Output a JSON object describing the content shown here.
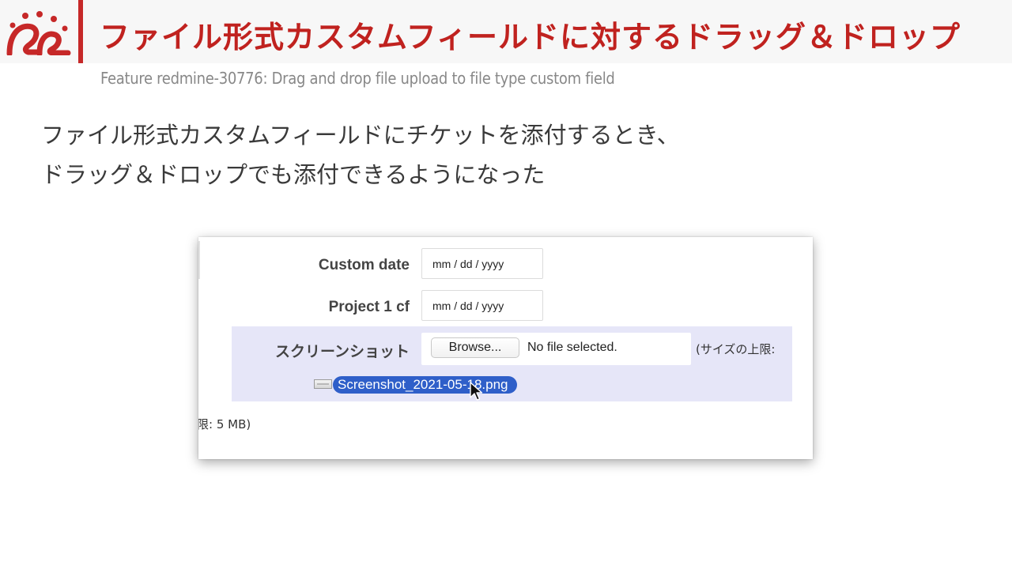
{
  "slide": {
    "title": "ファイル形式カスタムフィールドに対するドラッグ＆ドロップ",
    "subtitle": "Feature redmine-30776: Drag and drop file upload to file type custom field",
    "body_lines": [
      "ファイル形式カスタムフィールドにチケットを添付するとき、",
      "ドラッグ＆ドロップでも添付できるようになった"
    ],
    "brand_color": "#c0221f"
  },
  "form": {
    "custom_date": {
      "label": "Custom date",
      "placeholder": "mm / dd / yyyy"
    },
    "project_cf": {
      "label": "Project 1 cf",
      "placeholder": "mm / dd / yyyy"
    },
    "screenshot_field": {
      "label": "スクリーンショット",
      "browse_label": "Browse...",
      "status_text": "No file selected.",
      "size_limit_start": "(サイズの上限:",
      "size_limit_end": "限: 5 MB)",
      "band_color": "#e6e6f8"
    },
    "dragged_file": {
      "name": "Screenshot_2021-05-18.png",
      "pill_color": "#2f5fc9"
    }
  },
  "icons": {
    "logo": "redmine-logo-icon",
    "drag_file": "file-drag-icon",
    "cursor": "mouse-pointer-icon"
  }
}
